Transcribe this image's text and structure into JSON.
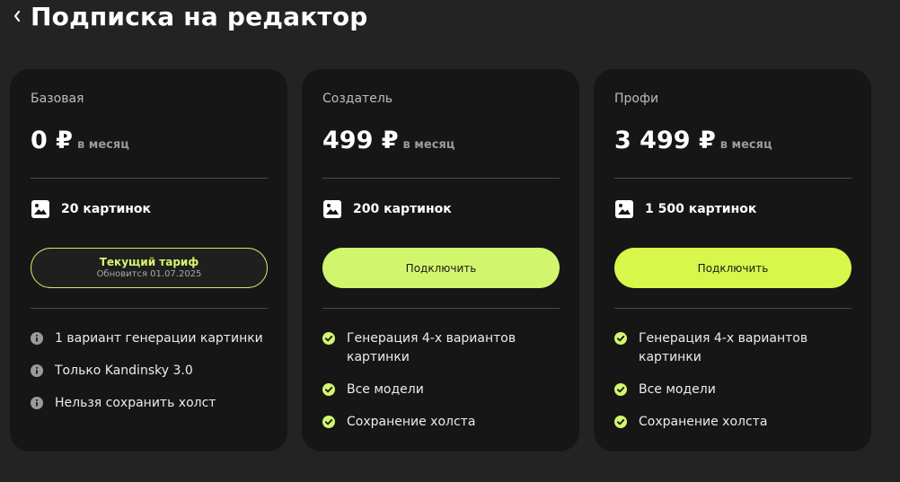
{
  "header": {
    "title": "Подписка на редактор",
    "back_icon": "chevron-left-icon"
  },
  "colors": {
    "background": "#232323",
    "card": "#161616",
    "accent": "#d2f56e",
    "accent_bright": "#d7f74a"
  },
  "plans": [
    {
      "name": "Базовая",
      "price": "0 ₽",
      "period": "в месяц",
      "images": "20 картинок",
      "button": {
        "type": "current",
        "title": "Текущий тариф",
        "subtitle": "Обновится 01.07.2025"
      },
      "feature_icon": "info-icon",
      "features": [
        "1 вариант генерации картинки",
        "Только Kandinsky 3.0",
        "Нельзя сохранить холст"
      ]
    },
    {
      "name": "Создатель",
      "price": "499 ₽",
      "period": "в месяц",
      "images": "200 картинок",
      "button": {
        "type": "connect",
        "label": "Подключить"
      },
      "feature_icon": "check-circle-icon",
      "features": [
        "Генерация 4-х вариантов картинки",
        "Все модели",
        "Сохранение холста"
      ]
    },
    {
      "name": "Профи",
      "price": "3 499 ₽",
      "period": "в месяц",
      "images": "1 500 картинок",
      "button": {
        "type": "connect",
        "label": "Подключить"
      },
      "feature_icon": "check-circle-icon",
      "features": [
        "Генерация 4-х вариантов картинки",
        "Все модели",
        "Сохранение холста"
      ]
    }
  ]
}
